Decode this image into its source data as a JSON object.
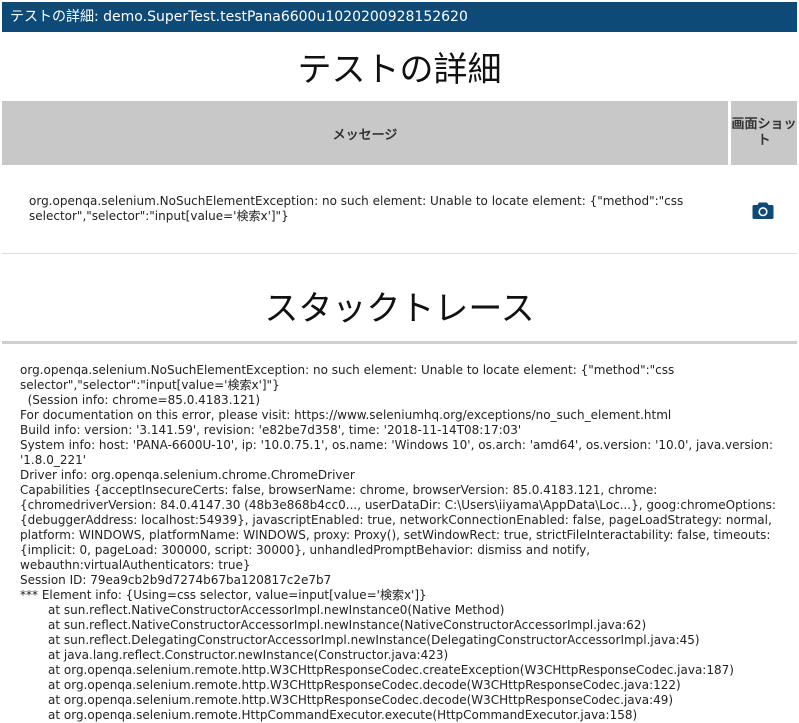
{
  "window": {
    "title": "テストの詳細: demo.SuperTest.testPana6600u1020200928152620"
  },
  "detail": {
    "heading": "テストの詳細",
    "columns": {
      "message": "メッセージ",
      "screenshot": "画面ショット"
    },
    "message_text": "org.openqa.selenium.NoSuchElementException: no such element: Unable to locate element: {\"method\":\"css selector\",\"selector\":\"input[value='検索x']\"}",
    "screenshot_icon": "camera-icon",
    "icon_color": "#0e4a77"
  },
  "stacktrace": {
    "heading": "スタックトレース",
    "lines": [
      "org.openqa.selenium.NoSuchElementException: no such element: Unable to locate element: {\"method\":\"css selector\",\"selector\":\"input[value='検索x']\"}",
      "  (Session info: chrome=85.0.4183.121)",
      "For documentation on this error, please visit: https://www.seleniumhq.org/exceptions/no_such_element.html",
      "Build info: version: '3.141.59', revision: 'e82be7d358', time: '2018-11-14T08:17:03'",
      "System info: host: 'PANA-6600U-10', ip: '10.0.75.1', os.name: 'Windows 10', os.arch: 'amd64', os.version: '10.0', java.version: '1.8.0_221'",
      "Driver info: org.openqa.selenium.chrome.ChromeDriver",
      "Capabilities {acceptInsecureCerts: false, browserName: chrome, browserVersion: 85.0.4183.121, chrome: {chromedriverVersion: 84.0.4147.30 (48b3e868b4cc0..., userDataDir: C:\\Users\\iiyama\\AppData\\Loc...}, goog:chromeOptions: {debuggerAddress: localhost:54939}, javascriptEnabled: true, networkConnectionEnabled: false, pageLoadStrategy: normal, platform: WINDOWS, platformName: WINDOWS, proxy: Proxy(), setWindowRect: true, strictFileInteractability: false, timeouts: {implicit: 0, pageLoad: 300000, script: 30000}, unhandledPromptBehavior: dismiss and notify, webauthn:virtualAuthenticators: true}",
      "Session ID: 79ea9cb2b9d7274b67ba120817c2e7b7",
      "*** Element info: {Using=css selector, value=input[value='検索x']}"
    ],
    "frames": [
      "at sun.reflect.NativeConstructorAccessorImpl.newInstance0(Native Method)",
      "at sun.reflect.NativeConstructorAccessorImpl.newInstance(NativeConstructorAccessorImpl.java:62)",
      "at sun.reflect.DelegatingConstructorAccessorImpl.newInstance(DelegatingConstructorAccessorImpl.java:45)",
      "at java.lang.reflect.Constructor.newInstance(Constructor.java:423)",
      "at org.openqa.selenium.remote.http.W3CHttpResponseCodec.createException(W3CHttpResponseCodec.java:187)",
      "at org.openqa.selenium.remote.http.W3CHttpResponseCodec.decode(W3CHttpResponseCodec.java:122)",
      "at org.openqa.selenium.remote.http.W3CHttpResponseCodec.decode(W3CHttpResponseCodec.java:49)",
      "at org.openqa.selenium.remote.HttpCommandExecutor.execute(HttpCommandExecutor.java:158)"
    ]
  }
}
